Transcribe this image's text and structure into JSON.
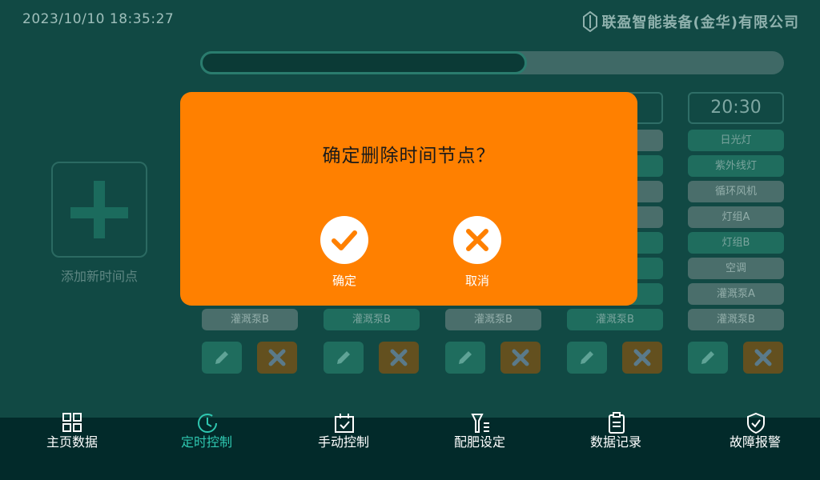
{
  "header": {
    "datetime": "2023/10/10  18:35:27",
    "company": "联盈智能装备(金华)有限公司"
  },
  "progress": {
    "fraction": 0.56
  },
  "add_card": {
    "label": "添加新时间点"
  },
  "columns": [
    {
      "time": "",
      "devices": [
        {
          "label": "",
          "state": "on"
        },
        {
          "label": "",
          "state": "on"
        },
        {
          "label": "",
          "state": "on"
        },
        {
          "label": "",
          "state": "on"
        },
        {
          "label": "",
          "state": "on"
        },
        {
          "label": "",
          "state": "on"
        },
        {
          "label": "",
          "state": "on"
        },
        {
          "label": "灌溉泵B",
          "state": "off"
        }
      ]
    },
    {
      "time": "",
      "devices": [
        {
          "label": "",
          "state": "on"
        },
        {
          "label": "",
          "state": "on"
        },
        {
          "label": "",
          "state": "on"
        },
        {
          "label": "",
          "state": "on"
        },
        {
          "label": "",
          "state": "on"
        },
        {
          "label": "",
          "state": "on"
        },
        {
          "label": "",
          "state": "on"
        },
        {
          "label": "灌溉泵B",
          "state": "on"
        }
      ]
    },
    {
      "time": "",
      "devices": [
        {
          "label": "",
          "state": "on"
        },
        {
          "label": "",
          "state": "on"
        },
        {
          "label": "",
          "state": "on"
        },
        {
          "label": "",
          "state": "on"
        },
        {
          "label": "",
          "state": "on"
        },
        {
          "label": "",
          "state": "on"
        },
        {
          "label": "",
          "state": "on"
        },
        {
          "label": "灌溉泵B",
          "state": "off"
        }
      ]
    },
    {
      "time": "",
      "devices": [
        {
          "label": "",
          "state": "off"
        },
        {
          "label": "",
          "state": "on"
        },
        {
          "label": "",
          "state": "off"
        },
        {
          "label": "",
          "state": "off"
        },
        {
          "label": "",
          "state": "on"
        },
        {
          "label": "",
          "state": "on"
        },
        {
          "label": "",
          "state": "on"
        },
        {
          "label": "灌溉泵B",
          "state": "on"
        }
      ]
    },
    {
      "time": "20:30",
      "devices": [
        {
          "label": "日光灯",
          "state": "on"
        },
        {
          "label": "紫外线灯",
          "state": "on"
        },
        {
          "label": "循环风机",
          "state": "off"
        },
        {
          "label": "灯组A",
          "state": "off"
        },
        {
          "label": "灯组B",
          "state": "on"
        },
        {
          "label": "空调",
          "state": "off"
        },
        {
          "label": "灌溉泵A",
          "state": "off"
        },
        {
          "label": "灌溉泵B",
          "state": "off"
        }
      ]
    }
  ],
  "modal": {
    "title": "确定删除时间节点？",
    "confirm_label": "确定",
    "cancel_label": "取消"
  },
  "nav": [
    {
      "label": "主页数据",
      "icon": "grid-icon",
      "active": false
    },
    {
      "label": "定时控制",
      "icon": "clock-icon",
      "active": true
    },
    {
      "label": "手动控制",
      "icon": "calendar-check-icon",
      "active": false
    },
    {
      "label": "配肥设定",
      "icon": "funnel-list-icon",
      "active": false
    },
    {
      "label": "数据记录",
      "icon": "clipboard-icon",
      "active": false
    },
    {
      "label": "故障报警",
      "icon": "shield-check-icon",
      "active": false
    }
  ],
  "colors": {
    "background": "#114944",
    "modal": "#ff8000",
    "nav_bg": "#022a2a",
    "active": "#2fc7b0",
    "device_on": "#1f6d5e",
    "device_off": "#4a6e6b",
    "delete_btn": "#63501f"
  }
}
